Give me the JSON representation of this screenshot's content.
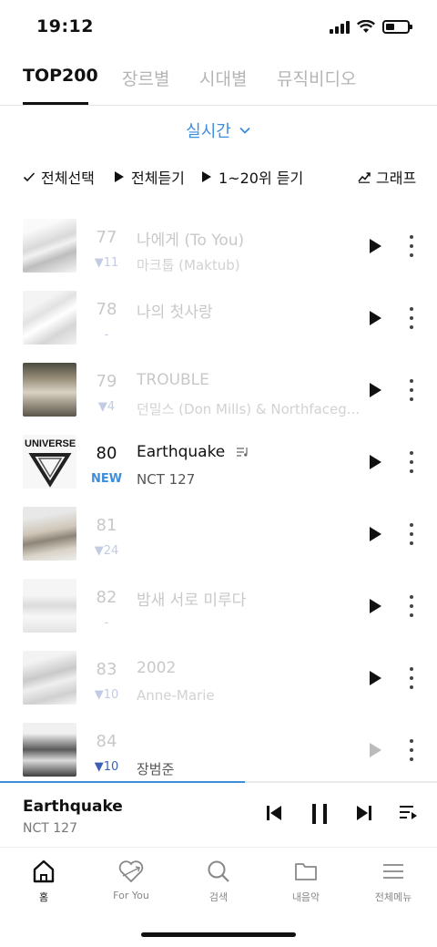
{
  "status_bar": {
    "time": "19:12",
    "battery_level": 0.4
  },
  "tabs": [
    {
      "label": "TOP200",
      "active": true
    },
    {
      "label": "장르별",
      "active": false
    },
    {
      "label": "시대별",
      "active": false
    },
    {
      "label": "뮤직비디오",
      "active": false
    }
  ],
  "filter": {
    "label": "실시간",
    "icon": "chevron-down-icon"
  },
  "actions": {
    "select_all": "전체선택",
    "play_all": "전체듣기",
    "play_top20": "1~20위 듣기",
    "graph": "그래프"
  },
  "chart": {
    "rows": [
      {
        "rank": "",
        "delta": "",
        "title": "",
        "artist": ""
      },
      {
        "rank": "77",
        "delta": "▼11",
        "title": "나에게 (To You)",
        "artist": "마크툽 (Maktub)",
        "faded": true
      },
      {
        "rank": "78",
        "delta": "-",
        "title": "나의 첫사랑",
        "artist": "",
        "faded": true
      },
      {
        "rank": "79",
        "delta": "▼4",
        "title": "TROUBLE",
        "artist": "던밀스 (Don Mills) & Northfaceg...",
        "faded": true
      },
      {
        "rank": "80",
        "delta": "NEW",
        "title": "Earthquake",
        "artist": "NCT 127",
        "faded": false
      },
      {
        "rank": "81",
        "delta": "▼24",
        "title": "",
        "artist": "",
        "faded": true
      },
      {
        "rank": "82",
        "delta": "-",
        "title": "밤새 서로 미루다",
        "artist": "",
        "faded": true
      },
      {
        "rank": "83",
        "delta": "▼10",
        "title": "2002",
        "artist": "Anne-Marie",
        "faded": true
      },
      {
        "rank": "84",
        "delta": "▼10",
        "title": "",
        "artist": "장범준",
        "faded": true
      }
    ]
  },
  "now_playing": {
    "title": "Earthquake",
    "artist": "NCT 127",
    "progress": 0.56
  },
  "bottom_nav": [
    {
      "label": "홈",
      "icon": "home-icon",
      "active": true
    },
    {
      "label": "For You",
      "icon": "heart-icon",
      "active": false
    },
    {
      "label": "검색",
      "icon": "search-icon",
      "active": false
    },
    {
      "label": "내음악",
      "icon": "folder-icon",
      "active": false
    },
    {
      "label": "전체메뉴",
      "icon": "menu-icon",
      "active": false
    }
  ],
  "colors": {
    "accent": "#3c8edc",
    "text": "#111111"
  }
}
